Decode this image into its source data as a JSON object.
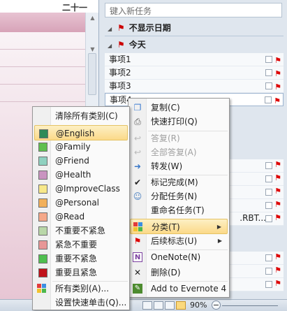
{
  "calendar": {
    "day_label": "二十一"
  },
  "task_pane": {
    "new_task_placeholder": "键入新任务",
    "group_no_date": "不显示日期",
    "group_today": "今天",
    "tasks": [
      {
        "label": "事项1"
      },
      {
        "label": "事项2"
      },
      {
        "label": "事项3"
      },
      {
        "label": "事项4"
      }
    ],
    "truncated_text": ".RBT..."
  },
  "context_menu": {
    "items": [
      {
        "label": "复制(C)",
        "icon": "copy-icon",
        "enabled": true
      },
      {
        "label": "快速打印(Q)",
        "icon": "print-icon",
        "enabled": true
      },
      {
        "label": "答复(R)",
        "icon": "reply-icon",
        "enabled": false
      },
      {
        "label": "全部答复(A)",
        "icon": "reply-all-icon",
        "enabled": false
      },
      {
        "label": "转发(W)",
        "icon": "forward-icon",
        "enabled": true
      },
      {
        "label": "标记完成(M)",
        "icon": "checkmark-icon",
        "enabled": true
      },
      {
        "label": "分配任务(N)",
        "icon": "assign-task-icon",
        "enabled": true
      },
      {
        "label": "重命名任务(T)",
        "icon": "",
        "enabled": true
      },
      {
        "label": "分类(T)",
        "icon": "categorize-icon",
        "enabled": true,
        "submenu": true,
        "highlighted": true
      },
      {
        "label": "后续标志(U)",
        "icon": "flag-icon",
        "enabled": true,
        "submenu": true
      },
      {
        "label": "OneNote(N)",
        "icon": "onenote-icon",
        "enabled": true
      },
      {
        "label": "删除(D)",
        "icon": "delete-icon",
        "enabled": true
      },
      {
        "label": "Add to Evernote 4",
        "icon": "evernote-icon",
        "enabled": true
      }
    ]
  },
  "category_menu": {
    "clear_all": "清除所有类别(C)",
    "categories": [
      {
        "label": "@English",
        "color": "#2e8b57",
        "highlighted": true
      },
      {
        "label": "@Family",
        "color": "#5fbf4f"
      },
      {
        "label": "@Friend",
        "color": "#8fd1c0"
      },
      {
        "label": "@Health",
        "color": "#c993c0"
      },
      {
        "label": "@ImproveClass",
        "color": "#f7e88a"
      },
      {
        "label": "@Personal",
        "color": "#f2b05a"
      },
      {
        "label": "@Read",
        "color": "#f5a889"
      },
      {
        "label": "不重要不紧急",
        "color": "#b9d7a8"
      },
      {
        "label": "紧急不重要",
        "color": "#e79696"
      },
      {
        "label": "重要不紧急",
        "color": "#4fbf4f"
      },
      {
        "label": "重要且紧急",
        "color": "#c0121a"
      }
    ],
    "all_categories": "所有类别(A)...",
    "set_quick_click": "设置快速单击(Q)..."
  },
  "status_bar": {
    "zoom": "90%"
  }
}
